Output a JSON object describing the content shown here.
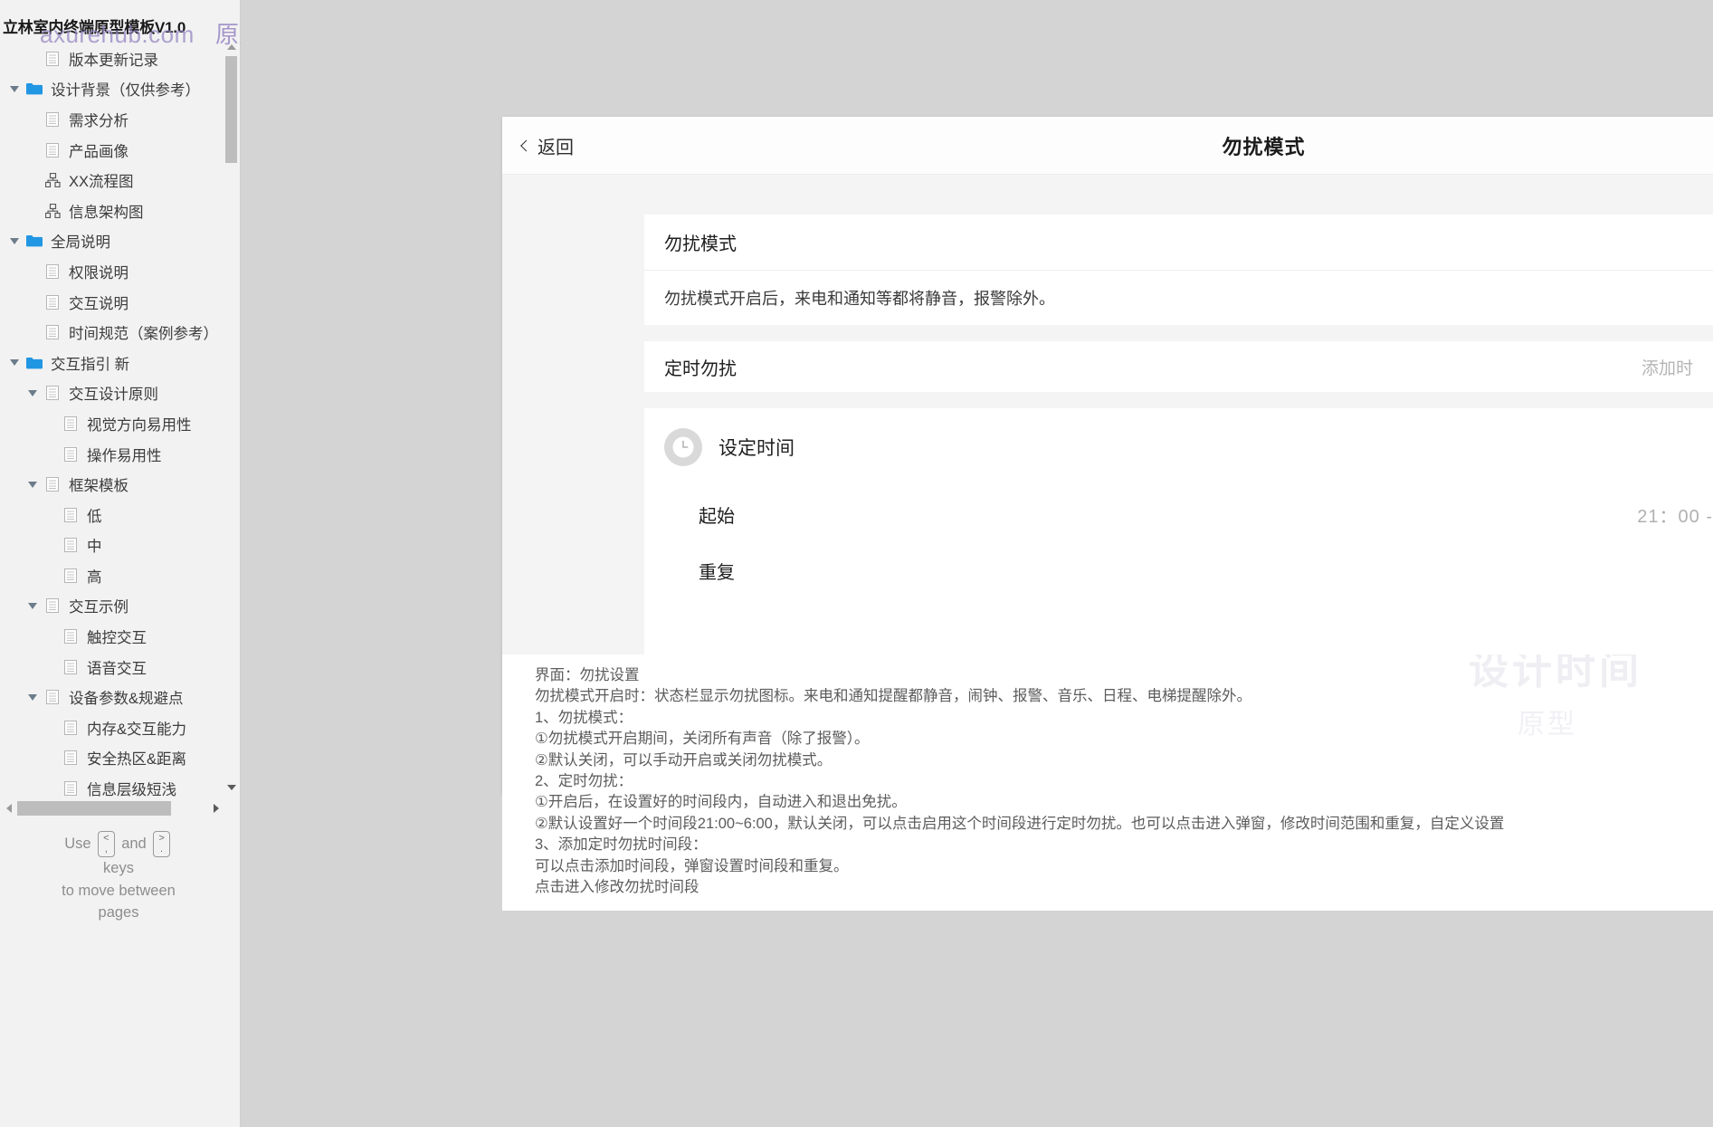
{
  "app": {
    "title": "立林室内终端原型模板V1.0",
    "watermark_site": "axurehub.com",
    "watermark_cn": "原型资源站"
  },
  "sidebar": {
    "hint": {
      "use": "Use",
      "and": "and",
      "keys": "keys",
      "move": "to move between",
      "pages": "pages",
      "key_prev_top": "<",
      "key_prev_bottom": ",",
      "key_next_top": ">",
      "key_next_bottom": "."
    },
    "items": [
      {
        "label": "版本更新记录",
        "icon": "page-icon",
        "indent": 1,
        "twisty": "none"
      },
      {
        "label": "设计背景（仅供参考）",
        "icon": "folder-icon",
        "indent": 0,
        "twisty": "open"
      },
      {
        "label": "需求分析",
        "icon": "page-icon",
        "indent": 1,
        "twisty": "none"
      },
      {
        "label": "产品画像",
        "icon": "page-icon",
        "indent": 1,
        "twisty": "none"
      },
      {
        "label": "XX流程图",
        "icon": "flow-icon",
        "indent": 1,
        "twisty": "none"
      },
      {
        "label": "信息架构图",
        "icon": "flow-icon",
        "indent": 1,
        "twisty": "none"
      },
      {
        "label": "全局说明",
        "icon": "folder-icon",
        "indent": 0,
        "twisty": "open"
      },
      {
        "label": "权限说明",
        "icon": "page-icon",
        "indent": 1,
        "twisty": "none"
      },
      {
        "label": "交互说明",
        "icon": "page-icon",
        "indent": 1,
        "twisty": "none"
      },
      {
        "label": "时间规范（案例参考）",
        "icon": "page-icon",
        "indent": 1,
        "twisty": "none"
      },
      {
        "label": "交互指引 新",
        "icon": "folder-icon",
        "indent": 0,
        "twisty": "open"
      },
      {
        "label": "交互设计原则",
        "icon": "page-icon",
        "indent": 1,
        "twisty": "open"
      },
      {
        "label": "视觉方向易用性",
        "icon": "page-icon",
        "indent": 2,
        "twisty": "none"
      },
      {
        "label": "操作易用性",
        "icon": "page-icon",
        "indent": 2,
        "twisty": "none"
      },
      {
        "label": "框架模板",
        "icon": "page-icon",
        "indent": 1,
        "twisty": "open"
      },
      {
        "label": "低",
        "icon": "page-icon",
        "indent": 2,
        "twisty": "none"
      },
      {
        "label": "中",
        "icon": "page-icon",
        "indent": 2,
        "twisty": "none"
      },
      {
        "label": "高",
        "icon": "page-icon",
        "indent": 2,
        "twisty": "none"
      },
      {
        "label": "交互示例",
        "icon": "page-icon",
        "indent": 1,
        "twisty": "open"
      },
      {
        "label": "触控交互",
        "icon": "page-icon",
        "indent": 2,
        "twisty": "none"
      },
      {
        "label": "语音交互",
        "icon": "page-icon",
        "indent": 2,
        "twisty": "none"
      },
      {
        "label": "设备参数&规避点",
        "icon": "page-icon",
        "indent": 1,
        "twisty": "open"
      },
      {
        "label": "内存&交互能力",
        "icon": "page-icon",
        "indent": 2,
        "twisty": "none"
      },
      {
        "label": "安全热区&距离",
        "icon": "page-icon",
        "indent": 2,
        "twisty": "none"
      },
      {
        "label": "信息层级短浅",
        "icon": "page-icon",
        "indent": 2,
        "twisty": "none"
      }
    ]
  },
  "screen": {
    "back_label": "返回",
    "title": "勿扰模式",
    "dnd": {
      "section_title": "勿扰模式",
      "description": "勿扰模式开启后，来电和通知等都将静音，报警除外。"
    },
    "scheduled": {
      "title": "定时勿扰",
      "add_label": "添加时"
    },
    "set_time": {
      "title": "设定时间",
      "rows": [
        {
          "label": "起始",
          "value": "21：00 -"
        },
        {
          "label": "重复",
          "value": ""
        }
      ]
    }
  },
  "annotation": {
    "lines": [
      "界面：勿扰设置",
      "勿扰模式开启时：状态栏显示勿扰图标。来电和通知提醒都静音，闹钟、报警、音乐、日程、电梯提醒除外。",
      "1、勿扰模式：",
      "①勿扰模式开启期间，关闭所有声音（除了报警）。",
      "②默认关闭，可以手动开启或关闭勿扰模式。",
      "2、定时勿扰：",
      "①开启后，在设置好的时间段内，自动进入和退出免扰。",
      "②默认设置好一个时间段21:00~6:00，默认关闭，可以点击启用这个时间段进行定时勿扰。也可以点击进入弹窗，修改时间范围和重复，自定义设置",
      "3、添加定时勿扰时间段：",
      "可以点击添加时间段，弹窗设置时间段和重复。",
      "点击进入修改勿扰时间段"
    ],
    "ghost_watermark": "设计时间",
    "ghost_watermark2": "原型"
  }
}
